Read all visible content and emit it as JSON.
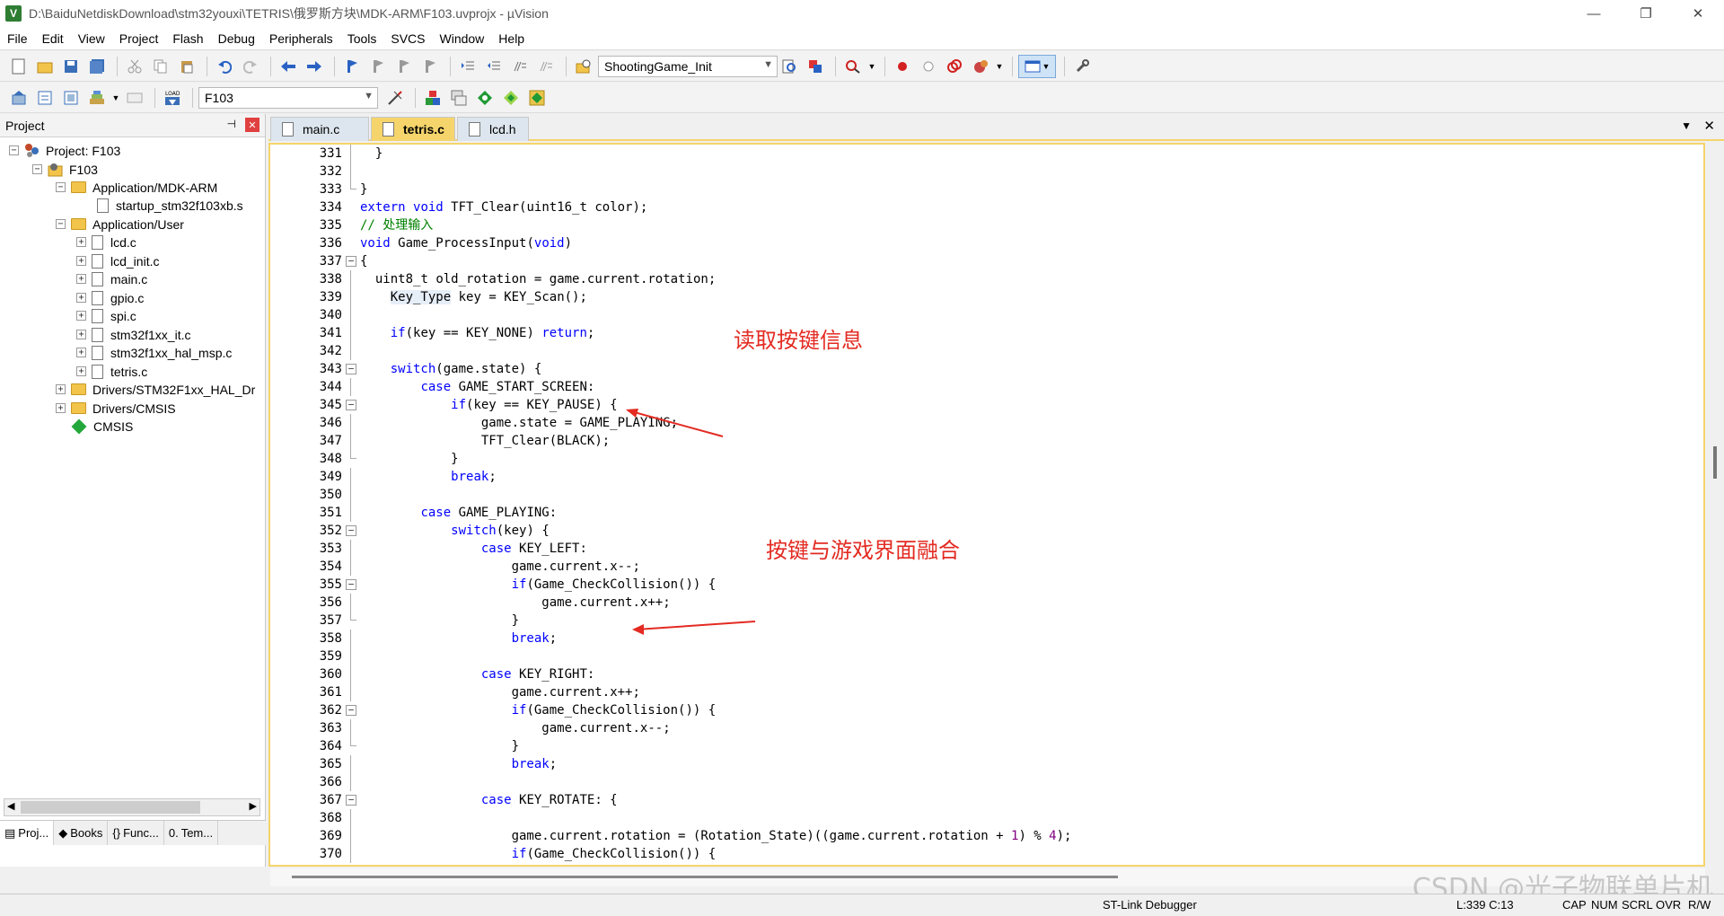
{
  "window": {
    "title": "D:\\BaiduNetdiskDownload\\stm32youxi\\TETRIS\\俄罗斯方块\\MDK-ARM\\F103.uvprojx - µVision",
    "app_icon_letter": "V",
    "minimize_label": "—",
    "restore_label": "❐",
    "close_label": "✕"
  },
  "menu": [
    "File",
    "Edit",
    "View",
    "Project",
    "Flash",
    "Debug",
    "Peripherals",
    "Tools",
    "SVCS",
    "Window",
    "Help"
  ],
  "toolbar": {
    "function_combo": "ShootingGame_Init",
    "target_combo": "F103"
  },
  "project_panel": {
    "title": "Project",
    "pin_label": "📌",
    "close_label": "✕",
    "tree": {
      "root": "Project: F103",
      "target": "F103",
      "groups": {
        "app_mdk": "Application/MDK-ARM",
        "startup_file": "startup_stm32f103xb.s",
        "app_user": "Application/User",
        "user_files": [
          "lcd.c",
          "lcd_init.c",
          "main.c",
          "gpio.c",
          "spi.c",
          "stm32f1xx_it.c",
          "stm32f1xx_hal_msp.c",
          "tetris.c"
        ],
        "drivers_hal": "Drivers/STM32F1xx_HAL_Dr",
        "drivers_cmsis": "Drivers/CMSIS",
        "cmsis": "CMSIS"
      }
    },
    "bottom_tabs": [
      "Proj...",
      "Books",
      "Func...",
      "Tem..."
    ]
  },
  "editor": {
    "tabs": [
      {
        "label": "main.c",
        "active": false
      },
      {
        "label": "tetris.c",
        "active": true
      },
      {
        "label": "lcd.h",
        "active": false
      }
    ],
    "lines": [
      {
        "n": "331",
        "code": "  }"
      },
      {
        "n": "332",
        "code": ""
      },
      {
        "n": "333",
        "code": "}"
      },
      {
        "n": "334",
        "code": "extern void TFT_Clear(uint16_t color);"
      },
      {
        "n": "335",
        "code": "// 处理输入"
      },
      {
        "n": "336",
        "code": "void Game_ProcessInput(void)"
      },
      {
        "n": "337",
        "code": "{"
      },
      {
        "n": "338",
        "code": "  uint8_t old_rotation = game.current.rotation;"
      },
      {
        "n": "339",
        "code": "    Key_Type key = KEY_Scan();"
      },
      {
        "n": "340",
        "code": ""
      },
      {
        "n": "341",
        "code": "    if(key == KEY_NONE) return;"
      },
      {
        "n": "342",
        "code": ""
      },
      {
        "n": "343",
        "code": "    switch(game.state) {"
      },
      {
        "n": "344",
        "code": "        case GAME_START_SCREEN:"
      },
      {
        "n": "345",
        "code": "            if(key == KEY_PAUSE) {"
      },
      {
        "n": "346",
        "code": "                game.state = GAME_PLAYING;"
      },
      {
        "n": "347",
        "code": "                TFT_Clear(BLACK);"
      },
      {
        "n": "348",
        "code": "            }"
      },
      {
        "n": "349",
        "code": "            break;"
      },
      {
        "n": "350",
        "code": ""
      },
      {
        "n": "351",
        "code": "        case GAME_PLAYING:"
      },
      {
        "n": "352",
        "code": "            switch(key) {"
      },
      {
        "n": "353",
        "code": "                case KEY_LEFT:"
      },
      {
        "n": "354",
        "code": "                    game.current.x--;"
      },
      {
        "n": "355",
        "code": "                    if(Game_CheckCollision()) {"
      },
      {
        "n": "356",
        "code": "                        game.current.x++;"
      },
      {
        "n": "357",
        "code": "                    }"
      },
      {
        "n": "358",
        "code": "                    break;"
      },
      {
        "n": "359",
        "code": ""
      },
      {
        "n": "360",
        "code": "                case KEY_RIGHT:"
      },
      {
        "n": "361",
        "code": "                    game.current.x++;"
      },
      {
        "n": "362",
        "code": "                    if(Game_CheckCollision()) {"
      },
      {
        "n": "363",
        "code": "                        game.current.x--;"
      },
      {
        "n": "364",
        "code": "                    }"
      },
      {
        "n": "365",
        "code": "                    break;"
      },
      {
        "n": "366",
        "code": ""
      },
      {
        "n": "367",
        "code": "                case KEY_ROTATE: {"
      },
      {
        "n": "368",
        "code": ""
      },
      {
        "n": "369",
        "code": "                    game.current.rotation = (Rotation_State)((game.current.rotation + 1) % 4);"
      },
      {
        "n": "370",
        "code": "                    if(Game_CheckCollision()) {"
      }
    ]
  },
  "annotations": {
    "read_key": "读取按键信息",
    "merge_key": "按键与游戏界面融合"
  },
  "status": {
    "debugger": "ST-Link Debugger",
    "position": "L:339 C:13",
    "flags": [
      "CAP",
      "NUM",
      "SCRL",
      "OVR",
      "R/W"
    ]
  },
  "watermark": "CSDN @光子物联单片机",
  "colors": {
    "keyword": "#0000ff",
    "comment": "#008000",
    "active_tab": "#f5d46b",
    "annotation": "#e32b22"
  }
}
